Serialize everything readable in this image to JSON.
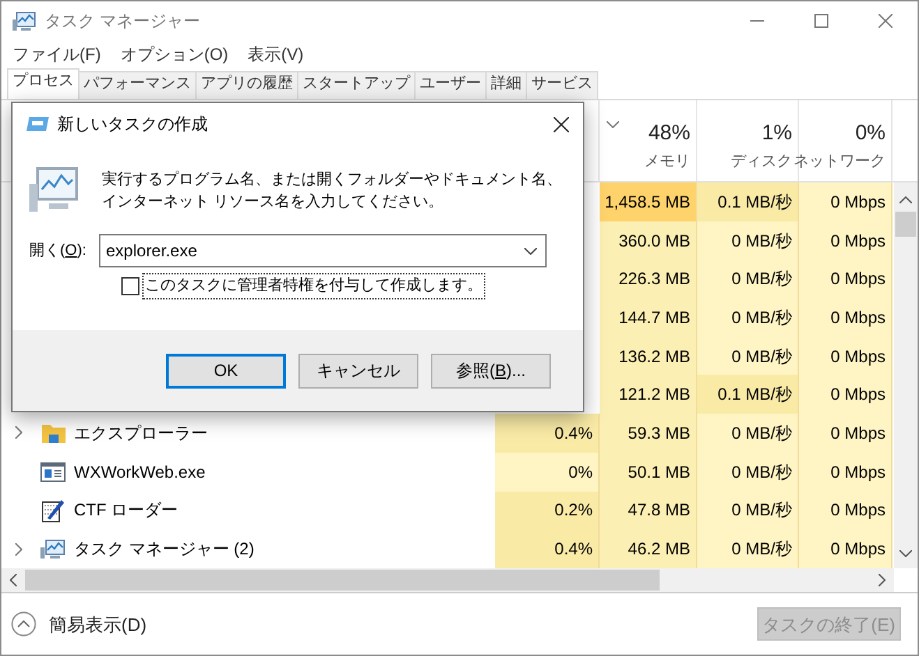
{
  "window": {
    "title": "タスク マネージャー"
  },
  "menu": [
    "ファイル(F)",
    "オプション(O)",
    "表示(V)"
  ],
  "tabs": [
    {
      "label": "プロセス",
      "selected": true
    },
    {
      "label": "パフォーマンス",
      "selected": false
    },
    {
      "label": "アプリの履歴",
      "selected": false
    },
    {
      "label": "スタートアップ",
      "selected": false
    },
    {
      "label": "ユーザー",
      "selected": false
    },
    {
      "label": "詳細",
      "selected": false
    },
    {
      "label": "サービス",
      "selected": false
    }
  ],
  "columns": [
    {
      "value": "48%",
      "label": "メモリ",
      "sorted": true
    },
    {
      "value": "1%",
      "label": "ディスク",
      "sorted": false
    },
    {
      "value": "0%",
      "label": "ネットワーク",
      "sorted": false
    }
  ],
  "rows": [
    {
      "memory": {
        "text": "1,458.5 MB",
        "color": "#ffd36b"
      },
      "disk": {
        "text": "0.1 MB/秒",
        "color": "#f9eaa6"
      },
      "network": {
        "text": "0 Mbps",
        "color": "#fff4c4"
      }
    },
    {
      "memory": {
        "text": "360.0 MB",
        "color": "#fbefb3"
      },
      "disk": {
        "text": "0 MB/秒",
        "color": "#fff4c4"
      },
      "network": {
        "text": "0 Mbps",
        "color": "#fff4c4"
      }
    },
    {
      "memory": {
        "text": "226.3 MB",
        "color": "#fbefb3"
      },
      "disk": {
        "text": "0 MB/秒",
        "color": "#fff4c4"
      },
      "network": {
        "text": "0 Mbps",
        "color": "#fff4c4"
      }
    },
    {
      "memory": {
        "text": "144.7 MB",
        "color": "#fbefb3"
      },
      "disk": {
        "text": "0 MB/秒",
        "color": "#fff4c4"
      },
      "network": {
        "text": "0 Mbps",
        "color": "#fff4c4"
      }
    },
    {
      "memory": {
        "text": "136.2 MB",
        "color": "#fbefb3"
      },
      "disk": {
        "text": "0 MB/秒",
        "color": "#fff4c4"
      },
      "network": {
        "text": "0 Mbps",
        "color": "#fff4c4"
      }
    },
    {
      "memory": {
        "text": "121.2 MB",
        "color": "#fbefb3"
      },
      "disk": {
        "text": "0.1 MB/秒",
        "color": "#f9eaa6"
      },
      "network": {
        "text": "0 Mbps",
        "color": "#fff4c4"
      }
    },
    {
      "name": "エクスプローラー",
      "expandable": true,
      "cpu": {
        "text": "0.4%",
        "color": "#f9eaa6"
      },
      "memory": {
        "text": "59.3 MB",
        "color": "#fbefb3"
      },
      "disk": {
        "text": "0 MB/秒",
        "color": "#fff4c4"
      },
      "network": {
        "text": "0 Mbps",
        "color": "#fff4c4"
      }
    },
    {
      "name": "WXWorkWeb.exe",
      "expandable": false,
      "cpu": {
        "text": "0%",
        "color": "#fff4c4"
      },
      "memory": {
        "text": "50.1 MB",
        "color": "#fbefb3"
      },
      "disk": {
        "text": "0 MB/秒",
        "color": "#fff4c4"
      },
      "network": {
        "text": "0 Mbps",
        "color": "#fff4c4"
      }
    },
    {
      "name": "CTF ローダー",
      "expandable": false,
      "cpu": {
        "text": "0.2%",
        "color": "#f9eaa6"
      },
      "memory": {
        "text": "47.8 MB",
        "color": "#fbefb3"
      },
      "disk": {
        "text": "0 MB/秒",
        "color": "#fff4c4"
      },
      "network": {
        "text": "0 Mbps",
        "color": "#fff4c4"
      }
    },
    {
      "name": "タスク マネージャー (2)",
      "expandable": true,
      "cpu": {
        "text": "0.4%",
        "color": "#f9eaa6"
      },
      "memory": {
        "text": "46.2 MB",
        "color": "#fbefb3"
      },
      "disk": {
        "text": "0 MB/秒",
        "color": "#fff4c4"
      },
      "network": {
        "text": "0 Mbps",
        "color": "#fff4c4"
      }
    }
  ],
  "footer": {
    "toggle": "簡易表示(D)",
    "end_task": {
      "label": "タスクの終了(E)",
      "disabled": true
    }
  },
  "dialog": {
    "title": "新しいタスクの作成",
    "message": "実行するプログラム名、または開くフォルダーやドキュメント名、インターネット リソース名を入力してください。",
    "open_label": {
      "before": "開く(",
      "mnemonic": "O",
      "after": "):"
    },
    "value": "explorer.exe",
    "admin_checkbox": {
      "label": "このタスクに管理者特権を付与して作成します。",
      "checked": false
    },
    "buttons": [
      {
        "before": "OK",
        "default": true
      },
      {
        "before": "キャンセル",
        "default": false
      },
      {
        "before": "参照(",
        "mnemonic": "B",
        "after": ")...",
        "default": false
      }
    ]
  }
}
